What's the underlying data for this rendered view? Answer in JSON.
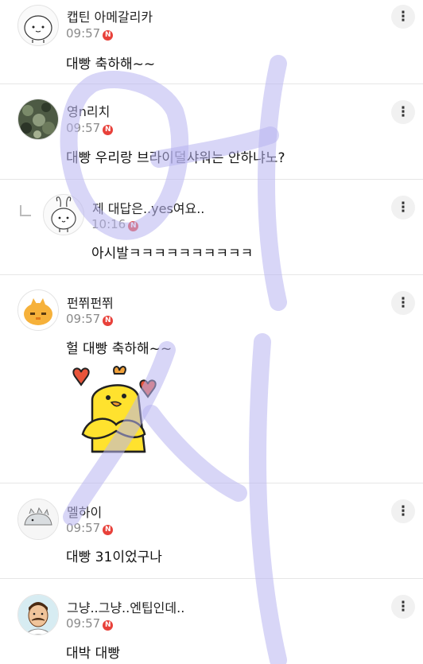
{
  "comments": [
    {
      "name": "캡틴 아메갈리카",
      "time": "09:57",
      "badge": "N",
      "text": "대빵 축하해~~"
    },
    {
      "name": "영n리치",
      "time": "09:57",
      "badge": "N",
      "text": "대빵 우리랑 브라이덜샤워는 안하냐노?"
    },
    {
      "name": "제 대답은..yes여요..",
      "time": "10:16",
      "badge": "N",
      "text": "아시발ㅋㅋㅋㅋㅋㅋㅋㅋㅋㅋ"
    },
    {
      "name": "펀쮜펀쮜",
      "time": "09:57",
      "badge": "N",
      "text": "헐 대빵 축하해~~"
    },
    {
      "name": "멜하이",
      "time": "09:57",
      "badge": "N",
      "text": "대빵 31이었구나"
    },
    {
      "name": "그냥..그냥..엔팁인데..",
      "time": "09:57",
      "badge": "N",
      "text": "대박 대빵"
    }
  ],
  "icons": {
    "more": "more-vertical-icon",
    "reply": "reply-arrow-icon",
    "new_badge": "new-badge-icon",
    "sticker": "chick-heart-sticker"
  },
  "colors": {
    "badge": "#e8413a",
    "watermark": "#b8b4f0",
    "sticker_yellow": "#ffe22e"
  }
}
